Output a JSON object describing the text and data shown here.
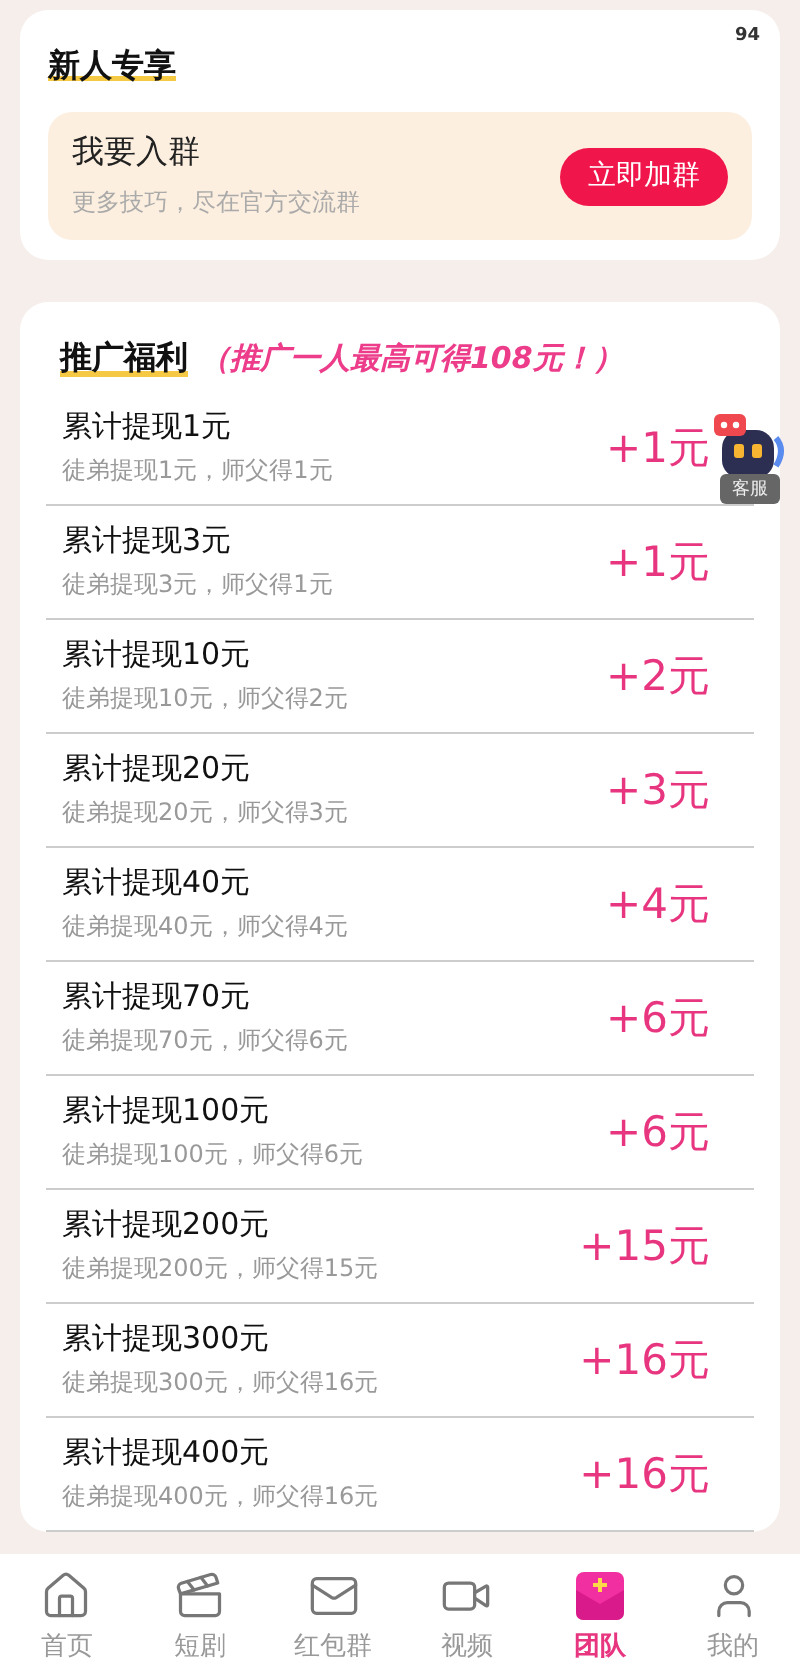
{
  "corner_number": "94",
  "newbie": {
    "title": "新人专享",
    "group": {
      "title": "我要入群",
      "subtitle": "更多技巧，尽在官方交流群",
      "button": "立即加群"
    }
  },
  "promo": {
    "title": "推广福利",
    "highlight": "（推广一人最高可得108元！）",
    "rows": [
      {
        "title": "累计提现1元",
        "detail": "徒弟提现1元，师父得1元",
        "reward": "+1元"
      },
      {
        "title": "累计提现3元",
        "detail": "徒弟提现3元，师父得1元",
        "reward": "+1元"
      },
      {
        "title": "累计提现10元",
        "detail": "徒弟提现10元，师父得2元",
        "reward": "+2元"
      },
      {
        "title": "累计提现20元",
        "detail": "徒弟提现20元，师父得3元",
        "reward": "+3元"
      },
      {
        "title": "累计提现40元",
        "detail": "徒弟提现40元，师父得4元",
        "reward": "+4元"
      },
      {
        "title": "累计提现70元",
        "detail": "徒弟提现70元，师父得6元",
        "reward": "+6元"
      },
      {
        "title": "累计提现100元",
        "detail": "徒弟提现100元，师父得6元",
        "reward": "+6元"
      },
      {
        "title": "累计提现200元",
        "detail": "徒弟提现200元，师父得15元",
        "reward": "+15元"
      },
      {
        "title": "累计提现300元",
        "detail": "徒弟提现300元，师父得16元",
        "reward": "+16元"
      },
      {
        "title": "累计提现400元",
        "detail": "徒弟提现400元，师父得16元",
        "reward": "+16元"
      }
    ]
  },
  "service": {
    "label": "客服"
  },
  "tab_bar": [
    {
      "label": "首页",
      "selected": false
    },
    {
      "label": "短剧",
      "selected": false
    },
    {
      "label": "红包群",
      "selected": false
    },
    {
      "label": "视频",
      "selected": false
    },
    {
      "label": "团队",
      "selected": true
    },
    {
      "label": "我的",
      "selected": false
    }
  ]
}
